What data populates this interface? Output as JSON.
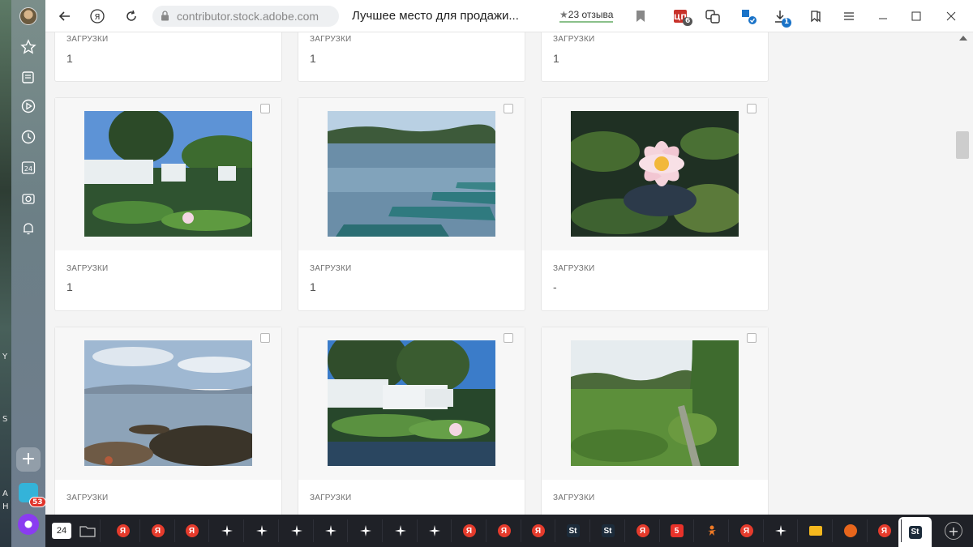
{
  "desktop": {
    "edge_letters": [
      "Y",
      "S",
      "A",
      "H"
    ]
  },
  "sidebar": {
    "items": [
      {
        "name": "favorites-star-icon"
      },
      {
        "name": "collections-icon"
      },
      {
        "name": "video-play-icon"
      },
      {
        "name": "history-clock-icon"
      },
      {
        "name": "calendar-24-icon",
        "label": "24"
      },
      {
        "name": "screenshot-camera-icon"
      },
      {
        "name": "notifications-bell-icon"
      }
    ],
    "messenger_badge": "53"
  },
  "topbar": {
    "url": "contributor.stock.adobe.com",
    "page_title": "Лучшее место для продажи...",
    "reviews": "23 отзыва",
    "ext_badge": "6",
    "download_badge": "1"
  },
  "cards": [
    {
      "label": "ЗАГРУЗКИ",
      "value": "1",
      "image": null
    },
    {
      "label": "ЗАГРУЗКИ",
      "value": "1",
      "image": null
    },
    {
      "label": "ЗАГРУЗКИ",
      "value": "1",
      "image": null
    },
    {
      "label": "ЗАГРУЗКИ",
      "value": "1",
      "image": "garden-pond-bench"
    },
    {
      "label": "ЗАГРУЗКИ",
      "value": "1",
      "image": "lake-canoes"
    },
    {
      "label": "ЗАГРУЗКИ",
      "value": "-",
      "image": "water-lily"
    },
    {
      "label": "ЗАГРУЗКИ",
      "value": "",
      "image": "rocky-shore"
    },
    {
      "label": "ЗАГРУЗКИ",
      "value": "",
      "image": "pond-bench-lily"
    },
    {
      "label": "ЗАГРУЗКИ",
      "value": "",
      "image": "garden-lawn"
    }
  ],
  "tabstrip": {
    "calendar_label": "24",
    "tabs": [
      {
        "icon": "yandex",
        "label": "Я",
        "color": "#e53b2c"
      },
      {
        "icon": "yandex",
        "label": "Я",
        "color": "#e53b2c"
      },
      {
        "icon": "yandex",
        "label": "Я",
        "color": "#e53b2c"
      },
      {
        "icon": "sparkle",
        "label": "",
        "color": "#ffffff"
      },
      {
        "icon": "sparkle",
        "label": "",
        "color": "#ffffff"
      },
      {
        "icon": "sparkle",
        "label": "",
        "color": "#ffffff"
      },
      {
        "icon": "sparkle",
        "label": "",
        "color": "#ffffff"
      },
      {
        "icon": "sparkle",
        "label": "",
        "color": "#ffffff"
      },
      {
        "icon": "sparkle",
        "label": "",
        "color": "#ffffff"
      },
      {
        "icon": "sparkle",
        "label": "",
        "color": "#ffffff"
      },
      {
        "icon": "yandex",
        "label": "Я",
        "color": "#e53b2c"
      },
      {
        "icon": "yandex",
        "label": "Я",
        "color": "#e53b2c"
      },
      {
        "icon": "yandex",
        "label": "Я",
        "color": "#e53b2c"
      },
      {
        "icon": "adobe-stock",
        "label": "St",
        "color": "#1c2b3a"
      },
      {
        "icon": "adobe-stock",
        "label": "St",
        "color": "#1c2b3a"
      },
      {
        "icon": "yandex",
        "label": "Я",
        "color": "#e53b2c"
      },
      {
        "icon": "channel-5",
        "label": "5",
        "color": "#e8322a"
      },
      {
        "icon": "orange-figure",
        "label": "",
        "color": "#f07a25"
      },
      {
        "icon": "yandex",
        "label": "Я",
        "color": "#e53b2c"
      },
      {
        "icon": "sparkle",
        "label": "",
        "color": "#ffffff"
      },
      {
        "icon": "mail",
        "label": "",
        "color": "#f5b81e"
      },
      {
        "icon": "orange-bowl",
        "label": "",
        "color": "#e8661c"
      },
      {
        "icon": "yandex",
        "label": "Я",
        "color": "#e53b2c"
      },
      {
        "icon": "adobe-stock",
        "label": "St",
        "color": "#1c2b3a"
      }
    ]
  }
}
